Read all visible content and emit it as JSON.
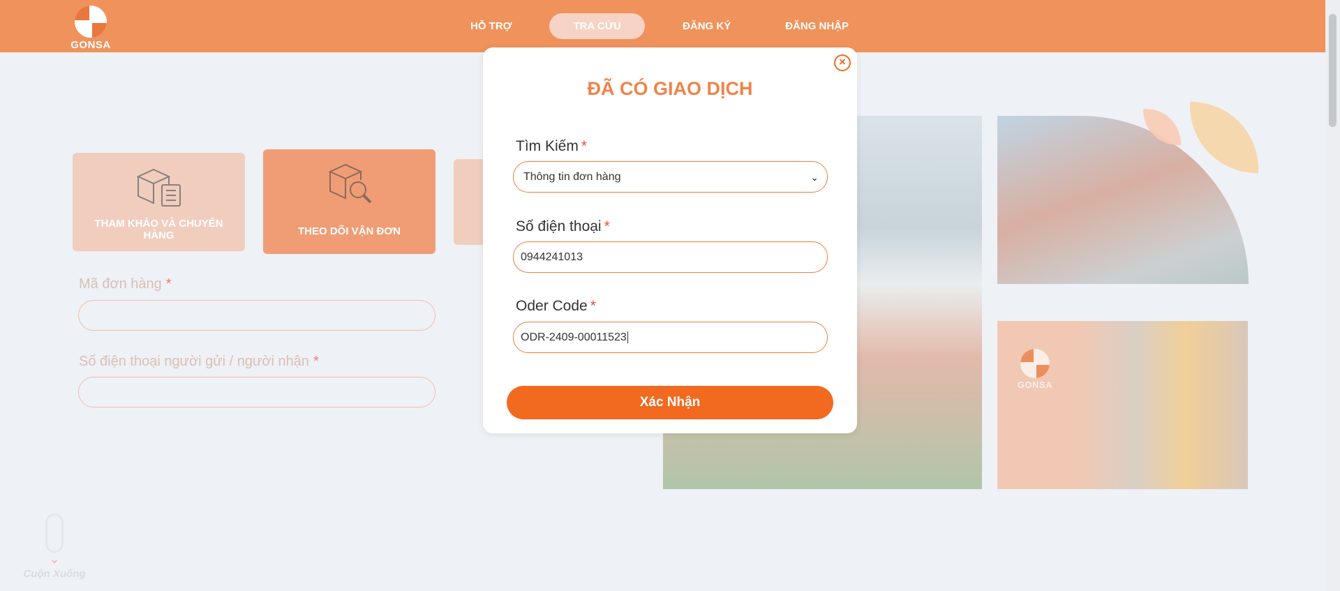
{
  "header": {
    "logo_text": "GONSA",
    "nav": [
      {
        "label": "HỖ TRỢ",
        "active": false
      },
      {
        "label": "TRA CỨU",
        "active": true
      },
      {
        "label": "ĐĂNG KÝ",
        "active": false
      },
      {
        "label": "ĐĂNG NHẬP",
        "active": false
      }
    ]
  },
  "cards": [
    {
      "label": "THAM KHẢO VÀ CHUYỂN HÀNG",
      "icon": "package-checklist-icon"
    },
    {
      "label": "THEO DÕI VẬN ĐƠN",
      "icon": "package-search-icon"
    }
  ],
  "form": {
    "order_code_label": "Mã đơn hàng",
    "phone_label": "Số điện thoại người gửi / người nhận",
    "required_mark": "*"
  },
  "photo_logo_text": "GONSA",
  "scroll_hint": "Cuộn Xuống",
  "modal": {
    "title": "ĐÃ CÓ GIAO DỊCH",
    "close_symbol": "×",
    "search_label": "Tìm Kiếm",
    "search_value": "Thông tin đơn hàng",
    "phone_label": "Số điện thoại",
    "phone_value": "0944241013",
    "order_label": "Oder Code",
    "order_value": "ODR-2409-00011523",
    "required_mark": "*",
    "submit_label": "Xác Nhận"
  },
  "colors": {
    "header": "#f0925b",
    "accent": "#f16a1f",
    "title": "#f0834a",
    "background": "#eef1f5"
  }
}
